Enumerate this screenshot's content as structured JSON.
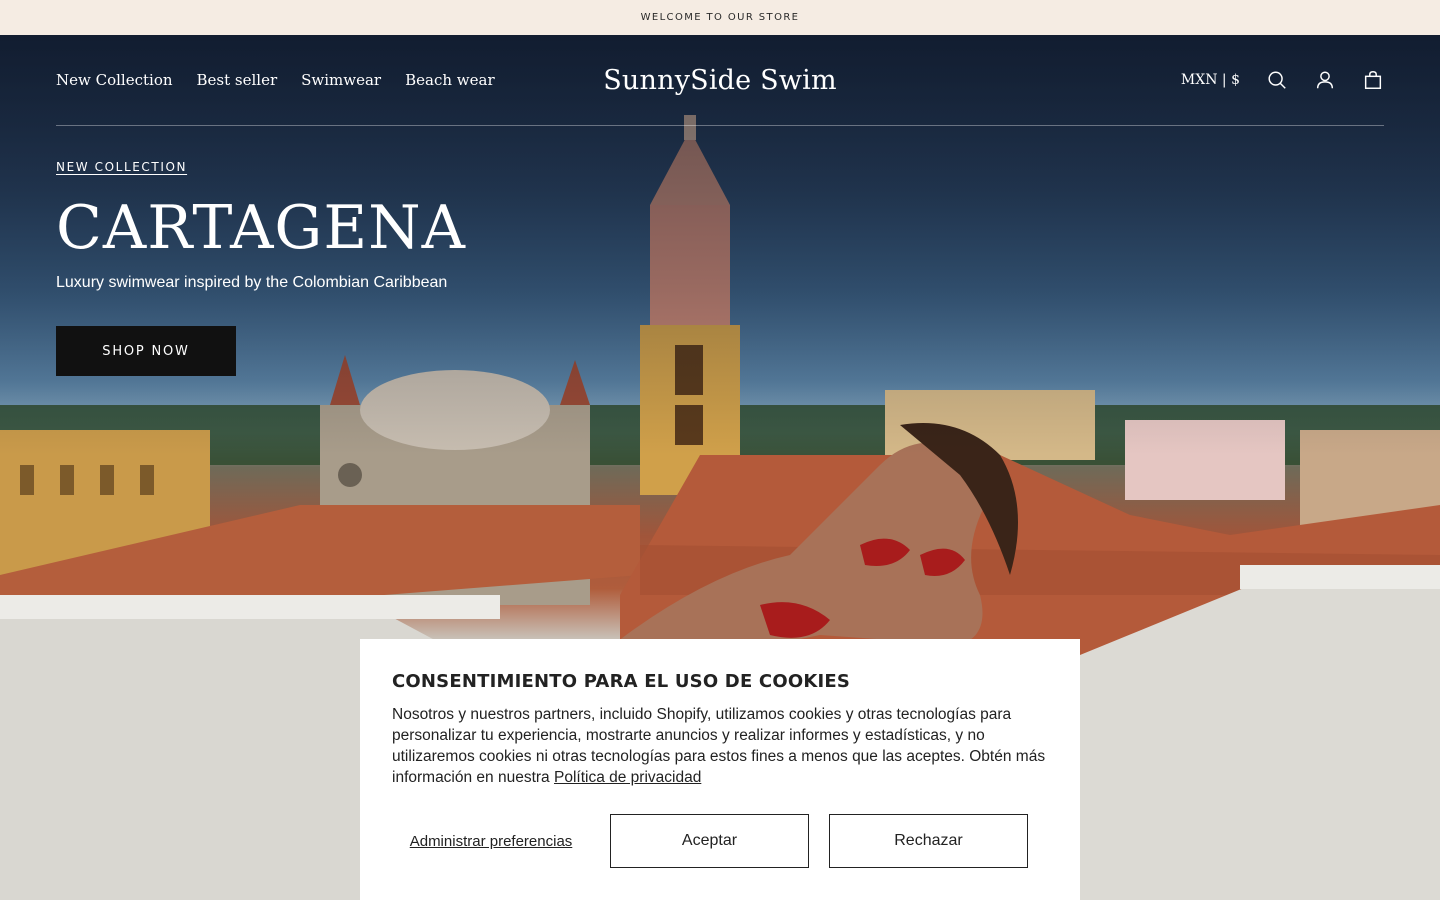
{
  "announcement": {
    "text": "WELCOME TO OUR STORE"
  },
  "header": {
    "nav": [
      {
        "label": "New Collection"
      },
      {
        "label": "Best seller"
      },
      {
        "label": "Swimwear"
      },
      {
        "label": "Beach wear"
      }
    ],
    "logo": "SunnySide Swim",
    "currency": "MXN | $",
    "icons": [
      "search-icon",
      "account-icon",
      "cart-icon"
    ]
  },
  "hero": {
    "eyebrow": "NEW COLLECTION",
    "title": "CARTAGENA",
    "subtitle": "Luxury swimwear inspired by the Colombian Caribbean",
    "cta": "SHOP NOW"
  },
  "cookie_banner": {
    "title": "CONSENTIMIENTO PARA EL USO DE COOKIES",
    "body": "Nosotros y nuestros partners, incluido Shopify, utilizamos cookies y otras tecnologías para personalizar tu experiencia, mostrarte anuncios y realizar informes y estadísticas, y no utilizaremos cookies ni otras tecnologías para estos fines a menos que las aceptes. Obtén más información en nuestra",
    "privacy_link": "Política de privacidad",
    "manage": "Administrar preferencias",
    "accept": "Aceptar",
    "reject": "Rechazar"
  },
  "colors": {
    "announcement_bg": "#f5ece3",
    "button_dark": "#111111",
    "text_light": "#ffffff"
  }
}
